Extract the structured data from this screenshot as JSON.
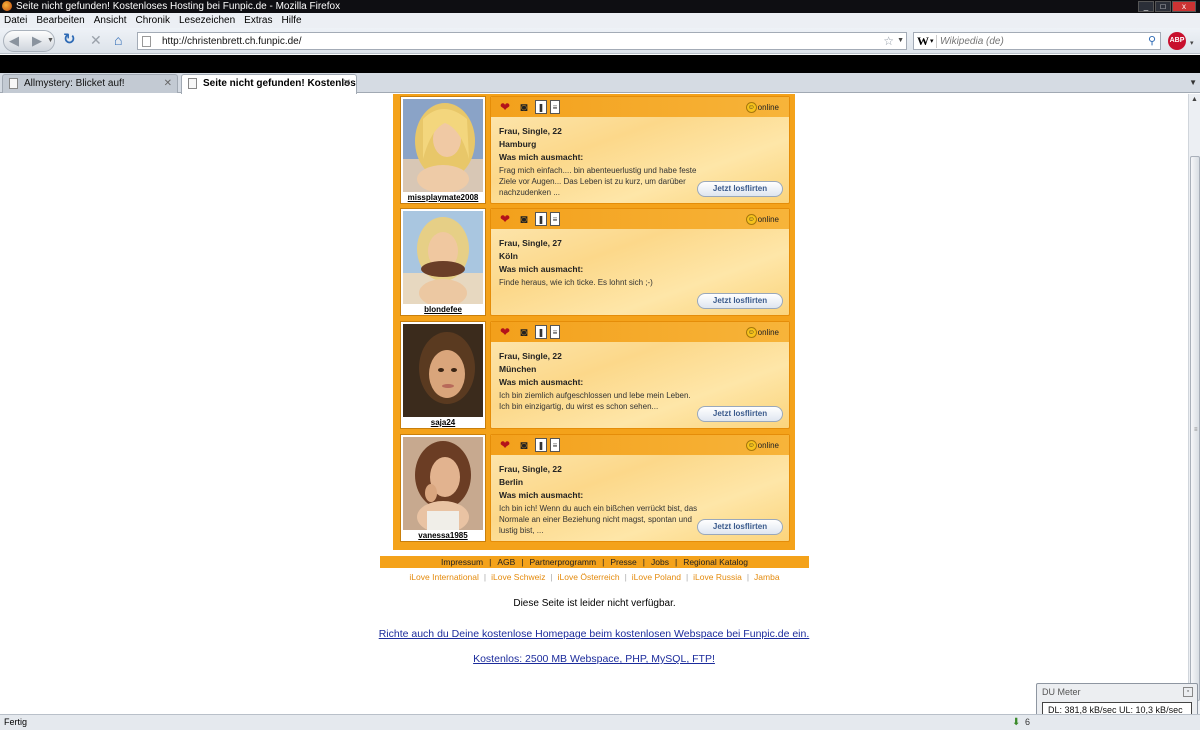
{
  "window": {
    "title": "Seite nicht gefunden! Kostenloses Hosting bei Funpic.de - Mozilla Firefox"
  },
  "menu": [
    "Datei",
    "Bearbeiten",
    "Ansicht",
    "Chronik",
    "Lesezeichen",
    "Extras",
    "Hilfe"
  ],
  "navbar": {
    "url": "http://christenbrett.ch.funpic.de/",
    "search_engine": "W",
    "search_placeholder": "Wikipedia (de)",
    "addon_label": "ABP"
  },
  "tabs": [
    {
      "label": "Allmystery: Blicket auf!",
      "active": false
    },
    {
      "label": "Seite nicht gefunden! Kostenlose...",
      "active": true
    }
  ],
  "profiles": [
    {
      "username": "missplaymate2008",
      "status": "online",
      "line1": "Frau, Single, 22",
      "city": "Hamburg",
      "heading": "Was mich ausmacht:",
      "bio": "Frag mich einfach.... bin abenteuerlustig und habe feste Ziele vor Augen... Das Leben ist zu kurz, um darüber nachzudenken ...",
      "button": "Jetzt losflirten"
    },
    {
      "username": "blondefee",
      "status": "online",
      "line1": "Frau, Single, 27",
      "city": "Köln",
      "heading": "Was mich ausmacht:",
      "bio": "Finde heraus, wie ich ticke. Es lohnt sich ;-)",
      "button": "Jetzt losflirten"
    },
    {
      "username": "saja24",
      "status": "online",
      "line1": "Frau, Single, 22",
      "city": "München",
      "heading": "Was mich ausmacht:",
      "bio": "Ich bin ziemlich aufgeschlossen und lebe mein Leben. Ich bin einzigartig, du wirst es schon sehen...",
      "button": "Jetzt losflirten"
    },
    {
      "username": "vanessa1985",
      "status": "online",
      "line1": "Frau, Single, 22",
      "city": "Berlin",
      "heading": "Was mich ausmacht:",
      "bio": "Ich bin ich! Wenn du auch ein bißchen verrückt bist, das Normale an einer Beziehung nicht magst, spontan und lustig bist, ...",
      "button": "Jetzt losflirten"
    }
  ],
  "footer_links": [
    "Impressum",
    "AGB",
    "Partnerprogramm",
    "Presse",
    "Jobs",
    "Regional Katalog"
  ],
  "footer_links2": [
    "iLove International",
    "iLove Schweiz",
    "iLove Österreich",
    "iLove Poland",
    "iLove Russia",
    "Jamba"
  ],
  "page": {
    "notice": "Diese Seite ist leider nicht verfügbar.",
    "promo1": "Richte auch du Deine kostenlose Homepage beim kostenlosen Webspace bei Funpic.de ein.",
    "promo2": "Kostenlos: 2500 MB Webspace, PHP, MySQL, FTP!"
  },
  "dumeter": {
    "title": "DU Meter",
    "values": "DL: 381,8 kB/sec  UL: 10,3 kB/sec"
  },
  "statusbar": {
    "text": "Fertig",
    "downloads": "6"
  },
  "colors": {
    "panel_orange": "#f4a21a",
    "link_blue": "#1c2c9c",
    "footer_orange": "#e48a0c"
  }
}
